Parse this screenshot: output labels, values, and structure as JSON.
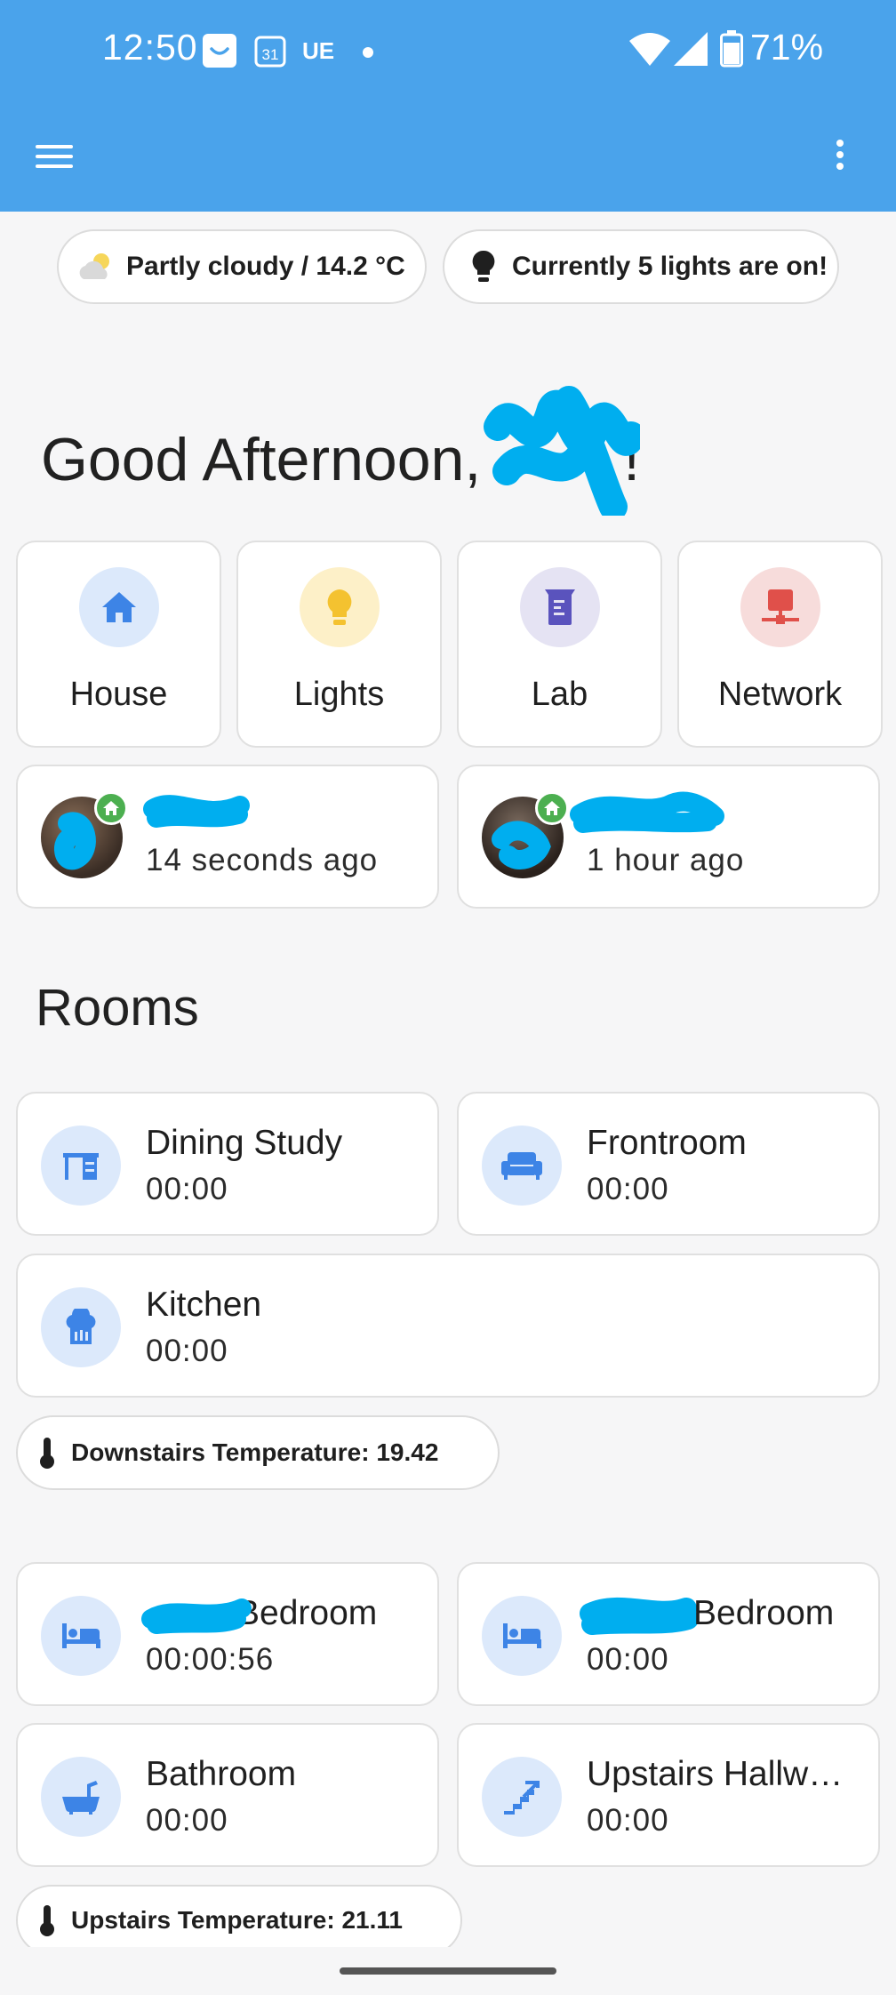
{
  "status_bar": {
    "time": "12:50",
    "calendar_day": "31",
    "carrier_text": "UE",
    "battery": "71%"
  },
  "chips": {
    "weather": "Partly cloudy / 14.2 °C",
    "lights": "Currently 5 lights are on!",
    "downstairs_temp": "Downstairs Temperature: 19.42",
    "upstairs_temp": "Upstairs Temperature: 21.11"
  },
  "greeting": "Good Afternoon,",
  "greeting_tail": "!",
  "nav": [
    {
      "label": "House",
      "icon": "home-icon",
      "bg": "#dce9fb",
      "color": "#3d84e6"
    },
    {
      "label": "Lights",
      "icon": "lightbulb-icon",
      "bg": "#fdf0c8",
      "color": "#f4c230"
    },
    {
      "label": "Lab",
      "icon": "beaker-icon",
      "bg": "#e5e3f3",
      "color": "#5a53bd"
    },
    {
      "label": "Network",
      "icon": "network-icon",
      "bg": "#f7dcdb",
      "color": "#e0504a"
    }
  ],
  "people": [
    {
      "last_seen": "14 seconds ago"
    },
    {
      "last_seen": "1 hour ago"
    }
  ],
  "rooms_title": "Rooms",
  "rooms": [
    {
      "name": "Dining Study",
      "value": "00:00",
      "icon": "desk-icon"
    },
    {
      "name": "Frontroom",
      "value": "00:00",
      "icon": "sofa-icon"
    },
    {
      "name": "Kitchen",
      "value": "00:00",
      "icon": "chef-hat-icon"
    },
    {
      "name": "Bedroom",
      "value": "00:00:56",
      "icon": "bed-icon"
    },
    {
      "name": "Bedroom",
      "value": "00:00",
      "icon": "bed-icon"
    },
    {
      "name": "Bathroom",
      "value": "00:00",
      "icon": "bath-icon"
    },
    {
      "name": "Upstairs Hallw…",
      "value": "00:00",
      "icon": "stairs-icon"
    }
  ],
  "colors": {
    "appbar": "#4aa3eb",
    "accent_blue": "#3d84e6",
    "scribble": "#00aeef"
  }
}
